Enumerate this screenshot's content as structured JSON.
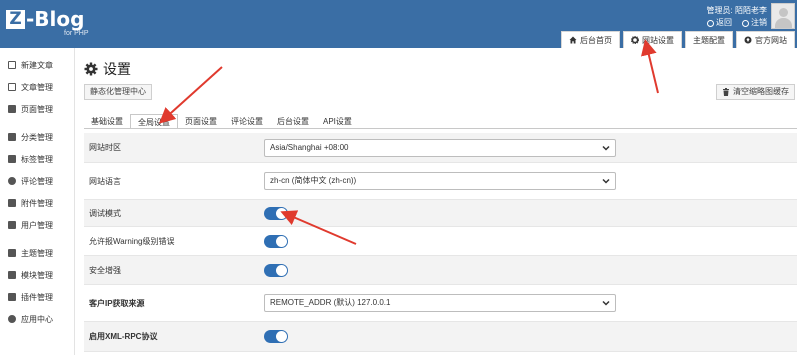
{
  "header": {
    "logo_mark": "Z",
    "logo_text": "-Blog",
    "logo_sub": "for PHP",
    "admin_label": "管理员: 陌陌老李",
    "return_label": "返回",
    "logout_label": "注销",
    "tabs": [
      {
        "label": "后台首页",
        "icon": "home-icon"
      },
      {
        "label": "网站设置",
        "icon": "gear-icon"
      },
      {
        "label": "主题配置",
        "icon": ""
      },
      {
        "label": "官方网站",
        "icon": "globe-icon"
      }
    ]
  },
  "sidebar": {
    "items": [
      {
        "label": "新建文章",
        "icon": "edit-icon"
      },
      {
        "label": "文章管理",
        "icon": "article-icon"
      },
      {
        "label": "页面管理",
        "icon": "page-icon"
      },
      {
        "label": "分类管理",
        "icon": "folder-icon"
      },
      {
        "label": "标签管理",
        "icon": "tag-icon"
      },
      {
        "label": "评论管理",
        "icon": "comment-icon"
      },
      {
        "label": "附件管理",
        "icon": "attachment-icon"
      },
      {
        "label": "用户管理",
        "icon": "users-icon"
      },
      {
        "label": "主题管理",
        "icon": "theme-icon"
      },
      {
        "label": "模块管理",
        "icon": "module-icon"
      },
      {
        "label": "插件管理",
        "icon": "plugin-icon"
      },
      {
        "label": "应用中心",
        "icon": "app-center-icon"
      }
    ]
  },
  "main": {
    "title": "设置",
    "static_button": "静态化管理中心",
    "clear_button": "清空缩略图缓存",
    "subtabs": [
      "基础设置",
      "全局设置",
      "页面设置",
      "评论设置",
      "后台设置",
      "API设置"
    ],
    "active_subtab": "全局设置",
    "settings": [
      {
        "label": "网站时区",
        "type": "select",
        "value": "Asia/Shanghai +08:00"
      },
      {
        "label": "网站语言",
        "type": "select",
        "value": "zh-cn (简体中文 (zh-cn))"
      },
      {
        "label": "调试模式",
        "type": "toggle",
        "value": "on"
      },
      {
        "label": "允许报Warning级别错误",
        "type": "toggle",
        "value": "on"
      },
      {
        "label": "安全增强",
        "type": "toggle",
        "value": "on"
      },
      {
        "label": "客户IP获取来源",
        "type": "select",
        "value": "REMOTE_ADDR (默认) 127.0.0.1"
      },
      {
        "label": "启用XML-RPC协议",
        "type": "toggle",
        "value": "on"
      }
    ]
  },
  "colors": {
    "header_bg": "#3a6ea5",
    "toggle_on": "#2f6fb4",
    "annotation_arrow": "#e03a2e"
  }
}
